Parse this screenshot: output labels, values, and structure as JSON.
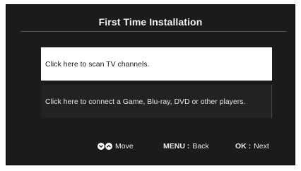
{
  "header": {
    "title": "First Time Installation"
  },
  "options": [
    {
      "label": "Click here to scan TV channels."
    },
    {
      "label": "Click here to connect a Game, Blu-ray, DVD or other players."
    }
  ],
  "footer": {
    "move_label": "Move",
    "back_key": "MENU :",
    "back_label": "Back",
    "next_key": "OK :",
    "next_label": "Next"
  },
  "icons": {
    "nav": [
      "chevron-down-icon",
      "chevron-up-icon"
    ]
  },
  "colors": {
    "background": "#1b1b1b",
    "text": "#f2f2f2",
    "selected_bg": "#ffffff",
    "selected_text": "#1a1a1a"
  }
}
